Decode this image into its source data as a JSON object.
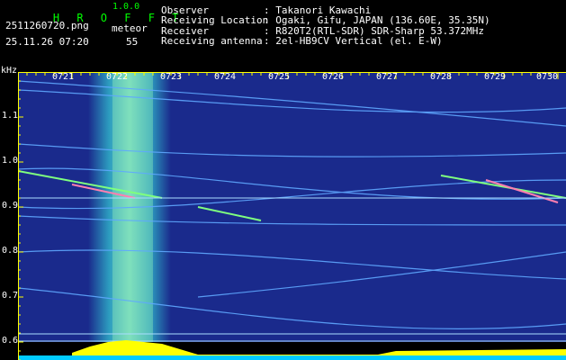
{
  "app": {
    "name": "H R O F F T",
    "version": "1.0.0"
  },
  "left": {
    "filename": "2511260720.png",
    "datetime": "25.11.26 07:20",
    "meteor_label": "meteor",
    "meteor_count": "55"
  },
  "info": {
    "labels": [
      "Observer",
      "Receiving Location",
      "Receiver",
      "Receiving antenna"
    ],
    "values": [
      ": Takanori Kawachi",
      ": Ogaki, Gifu, JAPAN (136.60E, 35.35N)",
      ": R820T2(RTL-SDR) SDR-Sharp 53.372MHz",
      ": 2el-HB9CV Vertical (el. E-W)"
    ]
  },
  "axis": {
    "unit": "kHz",
    "y_ticks": [
      "1.1",
      "1.0",
      "0.9",
      "0.8",
      "0.7",
      "0.6"
    ],
    "x_ticks": [
      "0721",
      "0722",
      "0723",
      "0724",
      "0725",
      "0726",
      "0727",
      "0728",
      "0729",
      "0730"
    ]
  },
  "colors": {
    "background": "#000000",
    "brand": "#00ff00",
    "spectrum_bg": "#1a2a8c",
    "axis": "#ffff00",
    "amplitude": "#ffff00",
    "baseline": "#00ccff"
  }
}
